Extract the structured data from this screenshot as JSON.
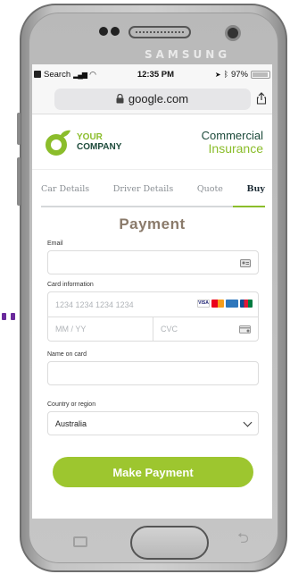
{
  "device": {
    "brand": "SAMSUNG"
  },
  "status_bar": {
    "back_app": "Search",
    "time": "12:35 PM",
    "battery": "97%"
  },
  "browser": {
    "url": "google.com"
  },
  "header": {
    "company_line1": "YOUR",
    "company_line2": "COMPANY",
    "product_line1": "Commercial",
    "product_line2": "Insurance"
  },
  "tabs": [
    {
      "label": "Car Details",
      "active": false
    },
    {
      "label": "Driver Details",
      "active": false
    },
    {
      "label": "Quote",
      "active": false
    },
    {
      "label": "Buy",
      "active": true
    }
  ],
  "payment": {
    "title": "Payment",
    "email_label": "Email",
    "email_value": "",
    "card_label": "Card information",
    "card_number_placeholder": "1234 1234 1234 1234",
    "expiry_placeholder": "MM / YY",
    "cvc_placeholder": "CVC",
    "card_brands": [
      "visa",
      "mastercard",
      "amex",
      "jcb"
    ],
    "name_label": "Name on card",
    "name_value": "",
    "country_label": "Country or region",
    "country_value": "Australia",
    "submit_label": "Make Payment"
  },
  "colors": {
    "accent": "#9dc62f",
    "brand_dark": "#1c4a3a",
    "brand_green": "#8bbd2b",
    "title": "#8a7a6a",
    "decor_dots": "#6a2a9c"
  },
  "icons": [
    "lock-icon",
    "share-icon",
    "contact-card-icon",
    "card-back-icon",
    "chevron-down-icon",
    "recent-apps-icon",
    "back-icon"
  ]
}
